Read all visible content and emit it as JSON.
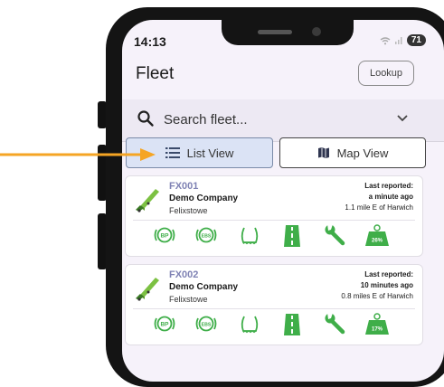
{
  "status_bar": {
    "time": "14:13",
    "battery": "71"
  },
  "header": {
    "title": "Fleet",
    "lookup_label": "Lookup"
  },
  "search": {
    "placeholder": "Search fleet..."
  },
  "view_toggle": {
    "list_label": "List View",
    "map_label": "Map View",
    "selected": "list"
  },
  "vehicles": [
    {
      "id": "FX001",
      "company": "Demo Company",
      "base": "Felixstowe",
      "last_reported_label": "Last reported:",
      "last_reported_time": "a minute ago",
      "distance": "1.1 mile E of Harwich",
      "status_labels": {
        "bp": "BP",
        "ebs": "EBS"
      },
      "load_percent": "26%",
      "icons": [
        "bp-icon",
        "ebs-icon",
        "tyre-icon",
        "road-icon",
        "wrench-icon",
        "weight-icon"
      ]
    },
    {
      "id": "FX002",
      "company": "Demo Company",
      "base": "Felixstowe",
      "last_reported_label": "Last reported:",
      "last_reported_time": "10 minutes ago",
      "distance": "0.8 miles E of Harwich",
      "status_labels": {
        "bp": "BP",
        "ebs": "EBS"
      },
      "load_percent": "17%",
      "icons": [
        "bp-icon",
        "ebs-icon",
        "tyre-icon",
        "road-icon",
        "wrench-icon",
        "weight-icon"
      ]
    }
  ],
  "colors": {
    "accent_green": "#3fae49",
    "vehicle_id": "#7f82b4",
    "arrow": "#f5a524",
    "list_selected_bg": "#dbe3f5"
  }
}
